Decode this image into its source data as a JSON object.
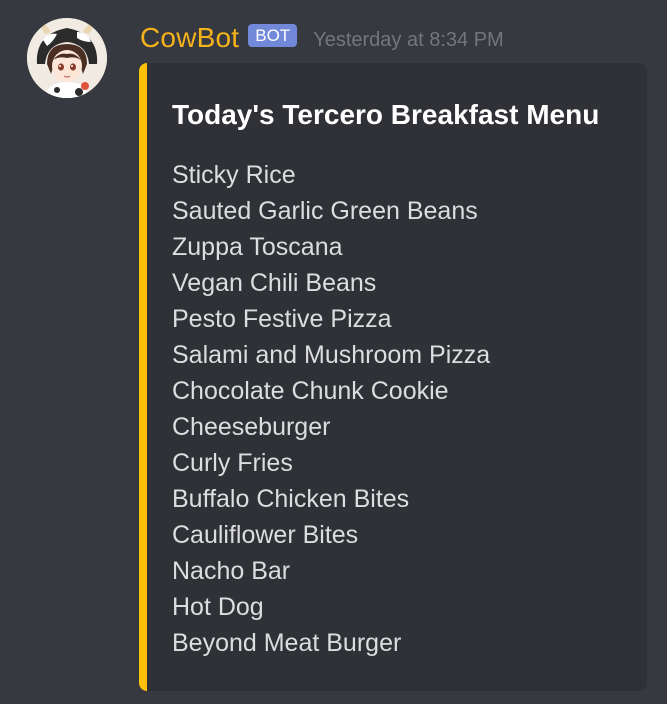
{
  "message": {
    "username": "CowBot",
    "bot_tag": "BOT",
    "timestamp": "Yesterday at 8:34 PM",
    "avatar_icon": "anime-cow-girl-avatar"
  },
  "embed": {
    "accent_color": "#ffc107",
    "title": "Today's Tercero Breakfast Menu",
    "items": [
      "Sticky Rice",
      "Sauted Garlic Green Beans",
      "Zuppa Toscana",
      "Vegan Chili Beans",
      "Pesto Festive Pizza",
      "Salami and Mushroom Pizza",
      "Chocolate Chunk Cookie",
      "Cheeseburger",
      "Curly Fries",
      "Buffalo Chicken Bites",
      "Cauliflower Bites",
      "Nacho Bar",
      "Hot Dog",
      "Beyond Meat Burger"
    ]
  },
  "colors": {
    "background": "#36393f",
    "embed_background": "#2f3136",
    "username": "#f5b21a",
    "bot_tag": "#7289da",
    "timestamp": "#72767d"
  }
}
